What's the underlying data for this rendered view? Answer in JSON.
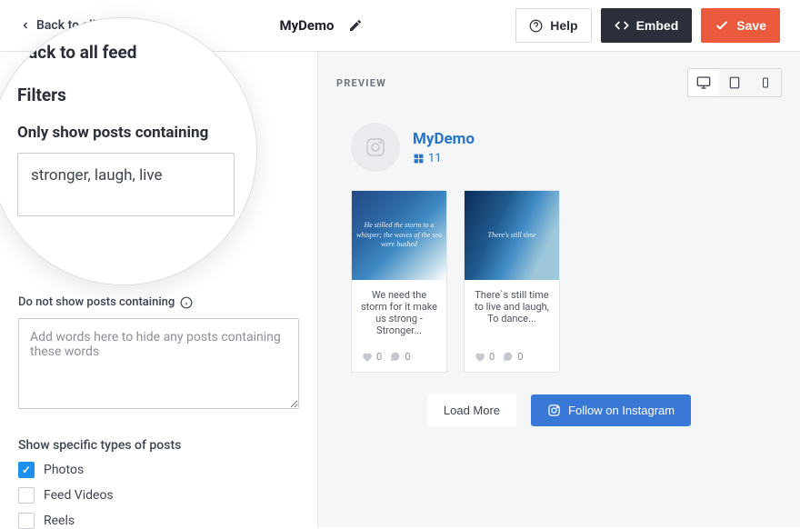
{
  "topbar": {
    "back_label": "Back to all feeds",
    "feed_name": "MyDemo",
    "help_label": "Help",
    "embed_label": "Embed",
    "save_label": "Save"
  },
  "magnifier": {
    "back_label": "Back to all feed",
    "filters_heading": "Filters",
    "only_label": "Only show posts containing",
    "only_value": "stronger, laugh, live"
  },
  "sidebar": {
    "exclude_label": "Do not show posts containing",
    "exclude_placeholder": "Add words here to hide any posts containing these words",
    "exclude_value": "",
    "types_heading": "Show specific types of posts",
    "types": [
      {
        "label": "Photos",
        "checked": true
      },
      {
        "label": "Feed Videos",
        "checked": false
      },
      {
        "label": "Reels",
        "checked": false
      }
    ]
  },
  "preview": {
    "label": "PREVIEW",
    "profile": {
      "name": "MyDemo",
      "count": "11"
    },
    "posts": [
      {
        "image_text": "He stilled the storm to a whisper; the waves of the sea were hushed",
        "caption": "We need the storm for it make us strong - Stronger...",
        "likes": "0",
        "comments": "0"
      },
      {
        "image_text": "There's still time",
        "caption": "There`s still time to live and laugh, To dance...",
        "likes": "0",
        "comments": "0"
      }
    ],
    "load_more_label": "Load More",
    "follow_label": "Follow on Instagram"
  }
}
